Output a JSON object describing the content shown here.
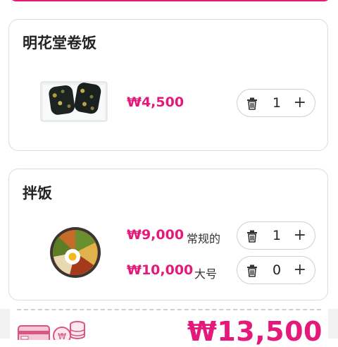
{
  "items": [
    {
      "name": "明花堂卷饭",
      "thumbnail_icon": "gimbap-image",
      "options": [
        {
          "price": "₩4,500",
          "label": "",
          "quantity": "1"
        }
      ]
    },
    {
      "name": "拌饭",
      "thumbnail_icon": "bibimbap-image",
      "options": [
        {
          "price": "₩9,000",
          "label": "常规的",
          "quantity": "1"
        },
        {
          "price": "₩10,000",
          "label": "大号",
          "quantity": "0"
        }
      ]
    }
  ],
  "stepper": {
    "plus_symbol": "+"
  },
  "footer": {
    "total": "₩13,500"
  },
  "colors": {
    "accent": "#e5197a",
    "border": "#dcdcdc",
    "footer_bg": "#f2f2f2"
  }
}
